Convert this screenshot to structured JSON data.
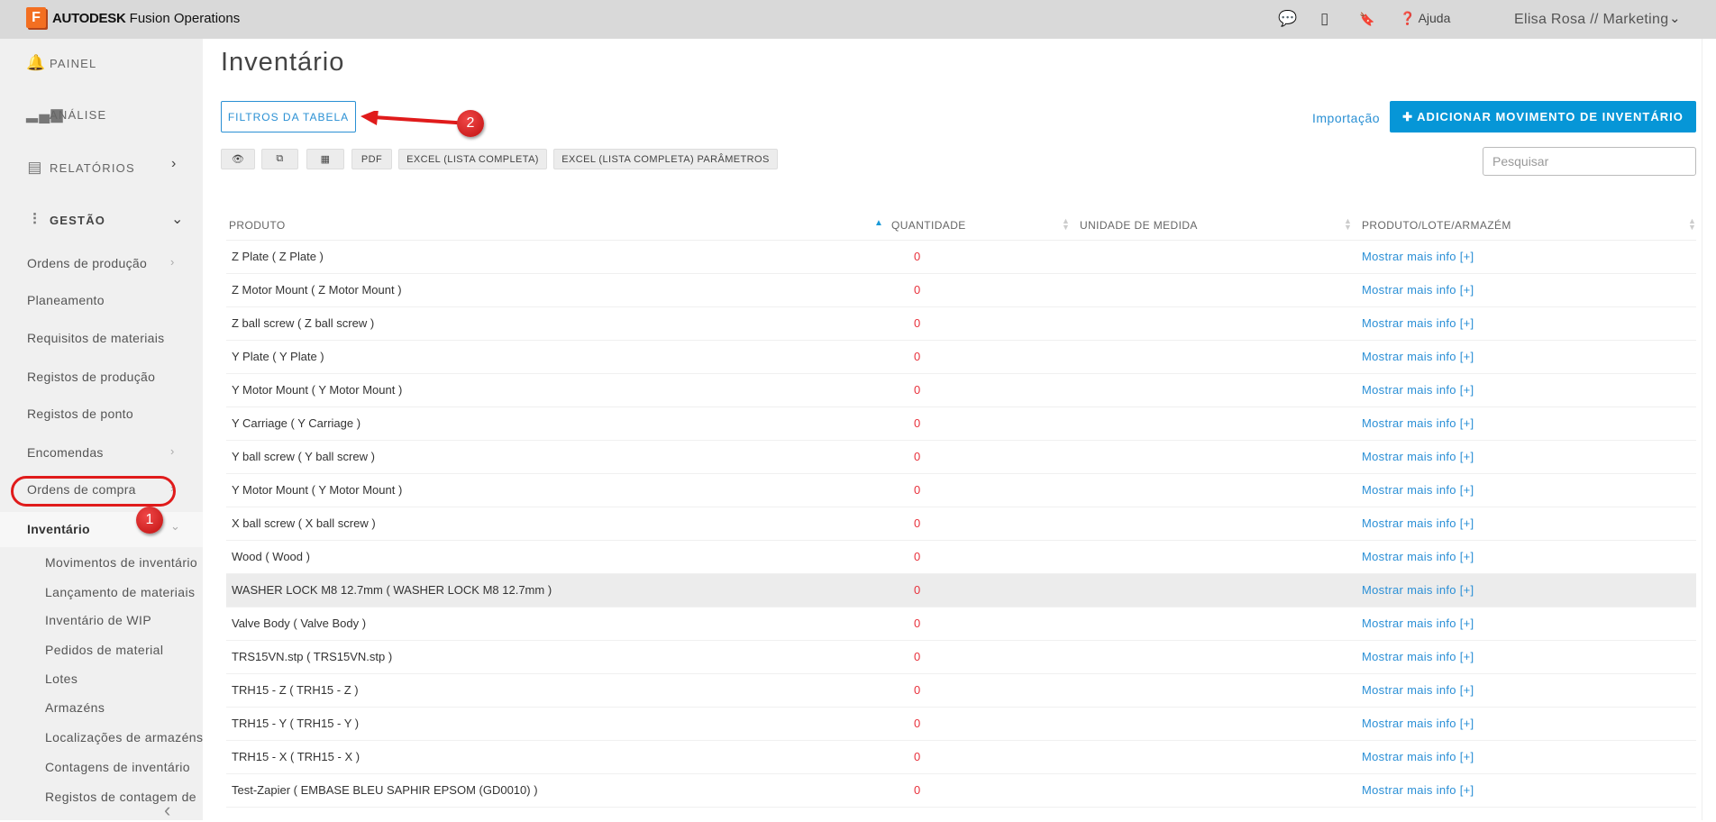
{
  "header": {
    "logo_letter": "F",
    "brand_bold": "AUTODESK",
    "brand_rest": "Fusion Operations",
    "help_label": "Ajuda",
    "user_label": "Elisa Rosa // Marketing"
  },
  "sidebar": {
    "sections": [
      {
        "label": "PAINEL"
      },
      {
        "label": "ANÁLISE"
      },
      {
        "label": "RELATÓRIOS"
      },
      {
        "label": "GESTÃO"
      }
    ],
    "items": [
      {
        "label": "Ordens de produção"
      },
      {
        "label": "Planeamento"
      },
      {
        "label": "Requisitos de materiais"
      },
      {
        "label": "Registos de produção"
      },
      {
        "label": "Registos de ponto"
      },
      {
        "label": "Encomendas"
      },
      {
        "label": "Ordens de compra"
      },
      {
        "label": "Inventário"
      }
    ],
    "inventory_subitems": [
      {
        "label": "Movimentos de inventário"
      },
      {
        "label": "Lançamento de materiais"
      },
      {
        "label": "Inventário de WIP"
      },
      {
        "label": "Pedidos de material"
      },
      {
        "label": "Lotes"
      },
      {
        "label": "Armazéns"
      },
      {
        "label": "Localizações de armazéns"
      },
      {
        "label": "Contagens de inventário"
      },
      {
        "label": "Registos de contagem de"
      }
    ]
  },
  "annotations": {
    "step1": "1",
    "step2": "2",
    "color": "#e01b1b"
  },
  "main": {
    "title": "Inventário",
    "filter_button": "FILTROS DA TABELA",
    "import_link": "Importação",
    "add_button": "ADICIONAR MOVIMENTO DE INVENTÁRIO",
    "search_placeholder": "Pesquisar",
    "toolbar": {
      "pdf": "PDF",
      "excel_full": "EXCEL (LISTA COMPLETA)",
      "excel_params": "EXCEL (LISTA COMPLETA) PARÂMETROS"
    },
    "columns": [
      "PRODUTO",
      "QUANTIDADE",
      "UNIDADE DE MEDIDA",
      "PRODUTO/LOTE/ARMAZÉM"
    ],
    "rows": [
      {
        "product": "Z Plate ( Z Plate )",
        "qty": "0",
        "link": "Mostrar mais info [+]"
      },
      {
        "product": "Z Motor Mount ( Z Motor Mount )",
        "qty": "0",
        "link": "Mostrar mais info [+]"
      },
      {
        "product": "Z ball screw ( Z ball screw )",
        "qty": "0",
        "link": "Mostrar mais info [+]"
      },
      {
        "product": "Y Plate ( Y Plate )",
        "qty": "0",
        "link": "Mostrar mais info [+]"
      },
      {
        "product": "Y Motor Mount ( Y Motor Mount )",
        "qty": "0",
        "link": "Mostrar mais info [+]"
      },
      {
        "product": "Y Carriage ( Y Carriage )",
        "qty": "0",
        "link": "Mostrar mais info [+]"
      },
      {
        "product": "Y ball screw ( Y ball screw )",
        "qty": "0",
        "link": "Mostrar mais info [+]"
      },
      {
        "product": "Y Motor Mount ( Y Motor Mount )",
        "qty": "0",
        "link": "Mostrar mais info [+]"
      },
      {
        "product": "X ball screw ( X ball screw )",
        "qty": "0",
        "link": "Mostrar mais info [+]"
      },
      {
        "product": "Wood ( Wood )",
        "qty": "0",
        "link": "Mostrar mais info [+]"
      },
      {
        "product": "WASHER LOCK M8 12.7mm ( WASHER LOCK M8 12.7mm )",
        "qty": "0",
        "link": "Mostrar mais info [+]"
      },
      {
        "product": "Valve Body ( Valve Body )",
        "qty": "0",
        "link": "Mostrar mais info [+]"
      },
      {
        "product": "TRS15VN.stp ( TRS15VN.stp )",
        "qty": "0",
        "link": "Mostrar mais info [+]"
      },
      {
        "product": "TRH15 - Z ( TRH15 - Z )",
        "qty": "0",
        "link": "Mostrar mais info [+]"
      },
      {
        "product": "TRH15 - Y ( TRH15 - Y )",
        "qty": "0",
        "link": "Mostrar mais info [+]"
      },
      {
        "product": "TRH15 - X ( TRH15 - X )",
        "qty": "0",
        "link": "Mostrar mais info [+]"
      },
      {
        "product": "Test-Zapier ( EMBASE BLEU SAPHIR EPSOM (GD0010) )",
        "qty": "0",
        "link": "Mostrar mais info [+]"
      }
    ]
  },
  "colors": {
    "accent": "#0696d7",
    "link": "#2a8fd6",
    "zero_qty": "#e8313c",
    "highlight_row": "#ececec"
  }
}
